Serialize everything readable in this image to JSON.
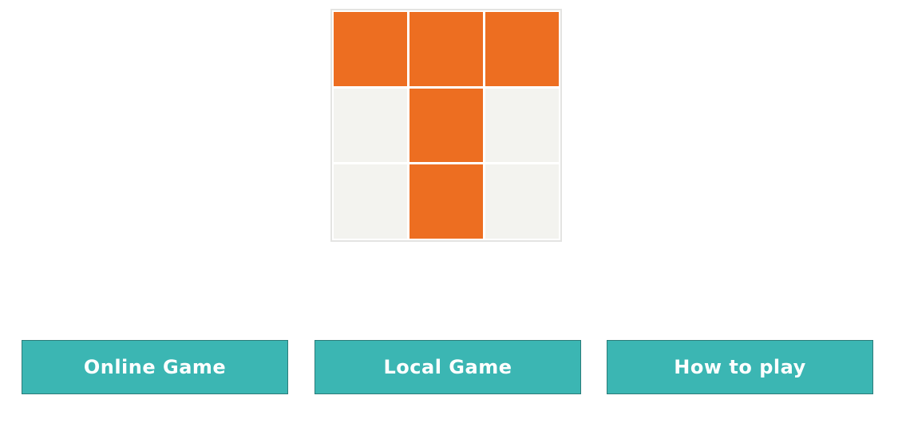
{
  "board": {
    "cells": [
      {
        "state": "filled"
      },
      {
        "state": "filled"
      },
      {
        "state": "filled"
      },
      {
        "state": "empty"
      },
      {
        "state": "filled"
      },
      {
        "state": "empty"
      },
      {
        "state": "empty"
      },
      {
        "state": "filled"
      },
      {
        "state": "empty"
      }
    ],
    "filled_color": "#ed6e21",
    "empty_color": "#f3f3ef"
  },
  "menu": {
    "online_label": "Online Game",
    "local_label": "Local Game",
    "howto_label": "How to play",
    "button_color": "#3bb6b3"
  }
}
